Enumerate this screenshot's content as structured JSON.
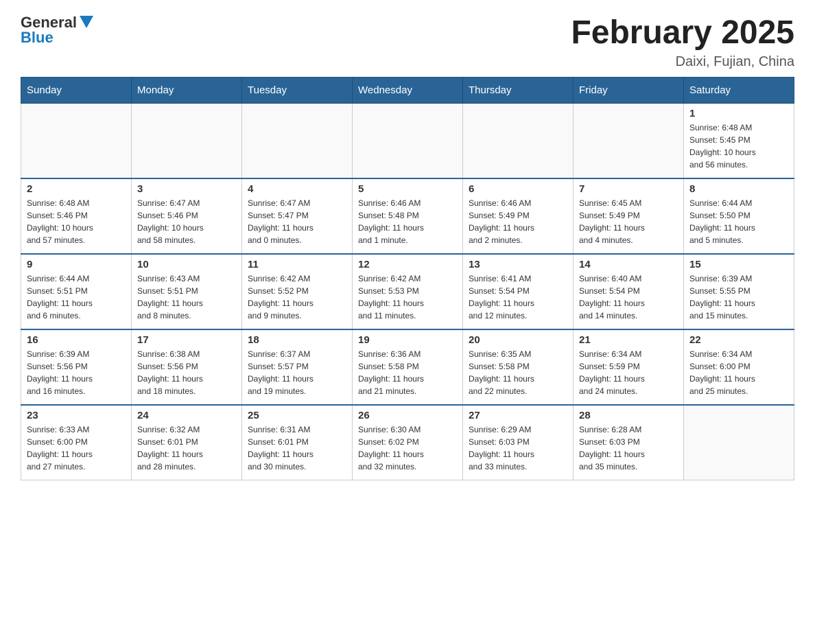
{
  "header": {
    "logo_general": "General",
    "logo_blue": "Blue",
    "month_title": "February 2025",
    "location": "Daixi, Fujian, China"
  },
  "days_of_week": [
    "Sunday",
    "Monday",
    "Tuesday",
    "Wednesday",
    "Thursday",
    "Friday",
    "Saturday"
  ],
  "weeks": [
    {
      "days": [
        {
          "number": "",
          "info": "",
          "empty": true
        },
        {
          "number": "",
          "info": "",
          "empty": true
        },
        {
          "number": "",
          "info": "",
          "empty": true
        },
        {
          "number": "",
          "info": "",
          "empty": true
        },
        {
          "number": "",
          "info": "",
          "empty": true
        },
        {
          "number": "",
          "info": "",
          "empty": true
        },
        {
          "number": "1",
          "info": "Sunrise: 6:48 AM\nSunset: 5:45 PM\nDaylight: 10 hours\nand 56 minutes."
        }
      ]
    },
    {
      "days": [
        {
          "number": "2",
          "info": "Sunrise: 6:48 AM\nSunset: 5:46 PM\nDaylight: 10 hours\nand 57 minutes."
        },
        {
          "number": "3",
          "info": "Sunrise: 6:47 AM\nSunset: 5:46 PM\nDaylight: 10 hours\nand 58 minutes."
        },
        {
          "number": "4",
          "info": "Sunrise: 6:47 AM\nSunset: 5:47 PM\nDaylight: 11 hours\nand 0 minutes."
        },
        {
          "number": "5",
          "info": "Sunrise: 6:46 AM\nSunset: 5:48 PM\nDaylight: 11 hours\nand 1 minute."
        },
        {
          "number": "6",
          "info": "Sunrise: 6:46 AM\nSunset: 5:49 PM\nDaylight: 11 hours\nand 2 minutes."
        },
        {
          "number": "7",
          "info": "Sunrise: 6:45 AM\nSunset: 5:49 PM\nDaylight: 11 hours\nand 4 minutes."
        },
        {
          "number": "8",
          "info": "Sunrise: 6:44 AM\nSunset: 5:50 PM\nDaylight: 11 hours\nand 5 minutes."
        }
      ]
    },
    {
      "days": [
        {
          "number": "9",
          "info": "Sunrise: 6:44 AM\nSunset: 5:51 PM\nDaylight: 11 hours\nand 6 minutes."
        },
        {
          "number": "10",
          "info": "Sunrise: 6:43 AM\nSunset: 5:51 PM\nDaylight: 11 hours\nand 8 minutes."
        },
        {
          "number": "11",
          "info": "Sunrise: 6:42 AM\nSunset: 5:52 PM\nDaylight: 11 hours\nand 9 minutes."
        },
        {
          "number": "12",
          "info": "Sunrise: 6:42 AM\nSunset: 5:53 PM\nDaylight: 11 hours\nand 11 minutes."
        },
        {
          "number": "13",
          "info": "Sunrise: 6:41 AM\nSunset: 5:54 PM\nDaylight: 11 hours\nand 12 minutes."
        },
        {
          "number": "14",
          "info": "Sunrise: 6:40 AM\nSunset: 5:54 PM\nDaylight: 11 hours\nand 14 minutes."
        },
        {
          "number": "15",
          "info": "Sunrise: 6:39 AM\nSunset: 5:55 PM\nDaylight: 11 hours\nand 15 minutes."
        }
      ]
    },
    {
      "days": [
        {
          "number": "16",
          "info": "Sunrise: 6:39 AM\nSunset: 5:56 PM\nDaylight: 11 hours\nand 16 minutes."
        },
        {
          "number": "17",
          "info": "Sunrise: 6:38 AM\nSunset: 5:56 PM\nDaylight: 11 hours\nand 18 minutes."
        },
        {
          "number": "18",
          "info": "Sunrise: 6:37 AM\nSunset: 5:57 PM\nDaylight: 11 hours\nand 19 minutes."
        },
        {
          "number": "19",
          "info": "Sunrise: 6:36 AM\nSunset: 5:58 PM\nDaylight: 11 hours\nand 21 minutes."
        },
        {
          "number": "20",
          "info": "Sunrise: 6:35 AM\nSunset: 5:58 PM\nDaylight: 11 hours\nand 22 minutes."
        },
        {
          "number": "21",
          "info": "Sunrise: 6:34 AM\nSunset: 5:59 PM\nDaylight: 11 hours\nand 24 minutes."
        },
        {
          "number": "22",
          "info": "Sunrise: 6:34 AM\nSunset: 6:00 PM\nDaylight: 11 hours\nand 25 minutes."
        }
      ]
    },
    {
      "days": [
        {
          "number": "23",
          "info": "Sunrise: 6:33 AM\nSunset: 6:00 PM\nDaylight: 11 hours\nand 27 minutes."
        },
        {
          "number": "24",
          "info": "Sunrise: 6:32 AM\nSunset: 6:01 PM\nDaylight: 11 hours\nand 28 minutes."
        },
        {
          "number": "25",
          "info": "Sunrise: 6:31 AM\nSunset: 6:01 PM\nDaylight: 11 hours\nand 30 minutes."
        },
        {
          "number": "26",
          "info": "Sunrise: 6:30 AM\nSunset: 6:02 PM\nDaylight: 11 hours\nand 32 minutes."
        },
        {
          "number": "27",
          "info": "Sunrise: 6:29 AM\nSunset: 6:03 PM\nDaylight: 11 hours\nand 33 minutes."
        },
        {
          "number": "28",
          "info": "Sunrise: 6:28 AM\nSunset: 6:03 PM\nDaylight: 11 hours\nand 35 minutes."
        },
        {
          "number": "",
          "info": "",
          "empty": true
        }
      ]
    }
  ]
}
